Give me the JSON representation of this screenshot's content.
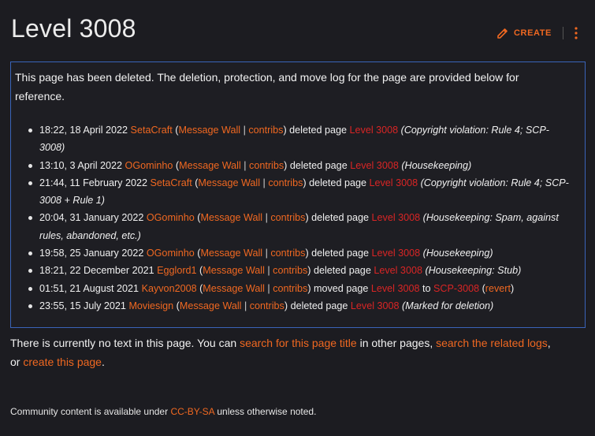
{
  "page": {
    "title": "Level 3008",
    "create_label": "CREATE"
  },
  "notice": {
    "intro": "This page has been deleted. The deletion, protection, and move log for the page are provided below for reference."
  },
  "log": [
    {
      "time": "18:22, 18 April 2022",
      "user": "SetaCraft",
      "wall": "Message Wall",
      "contribs": "contribs",
      "action": "deleted page",
      "page": "Level 3008",
      "comment": "(Copyright violation: Rule 4; SCP-3008)"
    },
    {
      "time": "13:10, 3 April 2022",
      "user": "OGominho",
      "wall": "Message Wall",
      "contribs": "contribs",
      "action": "deleted page",
      "page": "Level 3008",
      "comment": "(Housekeeping)"
    },
    {
      "time": "21:44, 11 February 2022",
      "user": "SetaCraft",
      "wall": "Message Wall",
      "contribs": "contribs",
      "action": "deleted page",
      "page": "Level 3008",
      "comment": "(Copyright violation: Rule 4; SCP-3008 + Rule 1)"
    },
    {
      "time": "20:04, 31 January 2022",
      "user": "OGominho",
      "wall": "Message Wall",
      "contribs": "contribs",
      "action": "deleted page",
      "page": "Level 3008",
      "comment": "(Housekeeping: Spam, against rules, abandoned, etc.)"
    },
    {
      "time": "19:58, 25 January 2022",
      "user": "OGominho",
      "wall": "Message Wall",
      "contribs": "contribs",
      "action": "deleted page",
      "page": "Level 3008",
      "comment": "(Housekeeping)"
    },
    {
      "time": "18:21, 22 December 2021",
      "user": "Egglord1",
      "wall": "Message Wall",
      "contribs": "contribs",
      "action": "deleted page",
      "page": "Level 3008",
      "comment": "(Housekeeping: Stub)"
    },
    {
      "time": "01:51, 21 August 2021",
      "user": "Kayvon2008",
      "wall": "Message Wall",
      "contribs": "contribs",
      "action": "moved page",
      "page": "Level 3008",
      "to_word": "to",
      "target": "SCP-3008",
      "revert": "revert"
    },
    {
      "time": "23:55, 15 July 2021",
      "user": "Moviesign",
      "wall": "Message Wall",
      "contribs": "contribs",
      "action": "deleted page",
      "page": "Level 3008",
      "comment": "(Marked for deletion)"
    }
  ],
  "no_text": {
    "prefix": "There is currently no text in this page. You can ",
    "link1": "search for this page title",
    "mid": " in other pages, ",
    "link2": "search the related logs",
    "sep": ",",
    "or": "or ",
    "link3": "create this page",
    "end": "."
  },
  "footer": {
    "prefix": "Community content is available under ",
    "license": "CC-BY-SA",
    "suffix": " unless otherwise noted."
  },
  "colors": {
    "accent": "#f06821",
    "deleted_link": "#d92525",
    "notice_border": "#3a64b9",
    "background": "#1c1c21"
  }
}
